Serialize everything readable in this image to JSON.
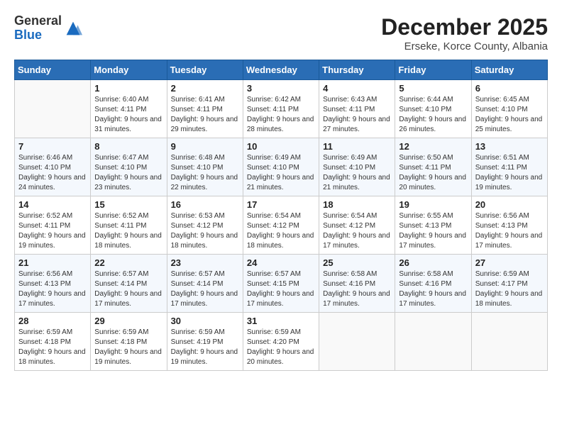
{
  "logo": {
    "general": "General",
    "blue": "Blue"
  },
  "title": "December 2025",
  "subtitle": "Erseke, Korce County, Albania",
  "days_header": [
    "Sunday",
    "Monday",
    "Tuesday",
    "Wednesday",
    "Thursday",
    "Friday",
    "Saturday"
  ],
  "weeks": [
    [
      {
        "day": "",
        "sunrise": "",
        "sunset": "",
        "daylight": ""
      },
      {
        "day": "1",
        "sunrise": "Sunrise: 6:40 AM",
        "sunset": "Sunset: 4:11 PM",
        "daylight": "Daylight: 9 hours and 31 minutes."
      },
      {
        "day": "2",
        "sunrise": "Sunrise: 6:41 AM",
        "sunset": "Sunset: 4:11 PM",
        "daylight": "Daylight: 9 hours and 29 minutes."
      },
      {
        "day": "3",
        "sunrise": "Sunrise: 6:42 AM",
        "sunset": "Sunset: 4:11 PM",
        "daylight": "Daylight: 9 hours and 28 minutes."
      },
      {
        "day": "4",
        "sunrise": "Sunrise: 6:43 AM",
        "sunset": "Sunset: 4:11 PM",
        "daylight": "Daylight: 9 hours and 27 minutes."
      },
      {
        "day": "5",
        "sunrise": "Sunrise: 6:44 AM",
        "sunset": "Sunset: 4:10 PM",
        "daylight": "Daylight: 9 hours and 26 minutes."
      },
      {
        "day": "6",
        "sunrise": "Sunrise: 6:45 AM",
        "sunset": "Sunset: 4:10 PM",
        "daylight": "Daylight: 9 hours and 25 minutes."
      }
    ],
    [
      {
        "day": "7",
        "sunrise": "Sunrise: 6:46 AM",
        "sunset": "Sunset: 4:10 PM",
        "daylight": "Daylight: 9 hours and 24 minutes."
      },
      {
        "day": "8",
        "sunrise": "Sunrise: 6:47 AM",
        "sunset": "Sunset: 4:10 PM",
        "daylight": "Daylight: 9 hours and 23 minutes."
      },
      {
        "day": "9",
        "sunrise": "Sunrise: 6:48 AM",
        "sunset": "Sunset: 4:10 PM",
        "daylight": "Daylight: 9 hours and 22 minutes."
      },
      {
        "day": "10",
        "sunrise": "Sunrise: 6:49 AM",
        "sunset": "Sunset: 4:10 PM",
        "daylight": "Daylight: 9 hours and 21 minutes."
      },
      {
        "day": "11",
        "sunrise": "Sunrise: 6:49 AM",
        "sunset": "Sunset: 4:10 PM",
        "daylight": "Daylight: 9 hours and 21 minutes."
      },
      {
        "day": "12",
        "sunrise": "Sunrise: 6:50 AM",
        "sunset": "Sunset: 4:11 PM",
        "daylight": "Daylight: 9 hours and 20 minutes."
      },
      {
        "day": "13",
        "sunrise": "Sunrise: 6:51 AM",
        "sunset": "Sunset: 4:11 PM",
        "daylight": "Daylight: 9 hours and 19 minutes."
      }
    ],
    [
      {
        "day": "14",
        "sunrise": "Sunrise: 6:52 AM",
        "sunset": "Sunset: 4:11 PM",
        "daylight": "Daylight: 9 hours and 19 minutes."
      },
      {
        "day": "15",
        "sunrise": "Sunrise: 6:52 AM",
        "sunset": "Sunset: 4:11 PM",
        "daylight": "Daylight: 9 hours and 18 minutes."
      },
      {
        "day": "16",
        "sunrise": "Sunrise: 6:53 AM",
        "sunset": "Sunset: 4:12 PM",
        "daylight": "Daylight: 9 hours and 18 minutes."
      },
      {
        "day": "17",
        "sunrise": "Sunrise: 6:54 AM",
        "sunset": "Sunset: 4:12 PM",
        "daylight": "Daylight: 9 hours and 18 minutes."
      },
      {
        "day": "18",
        "sunrise": "Sunrise: 6:54 AM",
        "sunset": "Sunset: 4:12 PM",
        "daylight": "Daylight: 9 hours and 17 minutes."
      },
      {
        "day": "19",
        "sunrise": "Sunrise: 6:55 AM",
        "sunset": "Sunset: 4:13 PM",
        "daylight": "Daylight: 9 hours and 17 minutes."
      },
      {
        "day": "20",
        "sunrise": "Sunrise: 6:56 AM",
        "sunset": "Sunset: 4:13 PM",
        "daylight": "Daylight: 9 hours and 17 minutes."
      }
    ],
    [
      {
        "day": "21",
        "sunrise": "Sunrise: 6:56 AM",
        "sunset": "Sunset: 4:13 PM",
        "daylight": "Daylight: 9 hours and 17 minutes."
      },
      {
        "day": "22",
        "sunrise": "Sunrise: 6:57 AM",
        "sunset": "Sunset: 4:14 PM",
        "daylight": "Daylight: 9 hours and 17 minutes."
      },
      {
        "day": "23",
        "sunrise": "Sunrise: 6:57 AM",
        "sunset": "Sunset: 4:14 PM",
        "daylight": "Daylight: 9 hours and 17 minutes."
      },
      {
        "day": "24",
        "sunrise": "Sunrise: 6:57 AM",
        "sunset": "Sunset: 4:15 PM",
        "daylight": "Daylight: 9 hours and 17 minutes."
      },
      {
        "day": "25",
        "sunrise": "Sunrise: 6:58 AM",
        "sunset": "Sunset: 4:16 PM",
        "daylight": "Daylight: 9 hours and 17 minutes."
      },
      {
        "day": "26",
        "sunrise": "Sunrise: 6:58 AM",
        "sunset": "Sunset: 4:16 PM",
        "daylight": "Daylight: 9 hours and 17 minutes."
      },
      {
        "day": "27",
        "sunrise": "Sunrise: 6:59 AM",
        "sunset": "Sunset: 4:17 PM",
        "daylight": "Daylight: 9 hours and 18 minutes."
      }
    ],
    [
      {
        "day": "28",
        "sunrise": "Sunrise: 6:59 AM",
        "sunset": "Sunset: 4:18 PM",
        "daylight": "Daylight: 9 hours and 18 minutes."
      },
      {
        "day": "29",
        "sunrise": "Sunrise: 6:59 AM",
        "sunset": "Sunset: 4:18 PM",
        "daylight": "Daylight: 9 hours and 19 minutes."
      },
      {
        "day": "30",
        "sunrise": "Sunrise: 6:59 AM",
        "sunset": "Sunset: 4:19 PM",
        "daylight": "Daylight: 9 hours and 19 minutes."
      },
      {
        "day": "31",
        "sunrise": "Sunrise: 6:59 AM",
        "sunset": "Sunset: 4:20 PM",
        "daylight": "Daylight: 9 hours and 20 minutes."
      },
      {
        "day": "",
        "sunrise": "",
        "sunset": "",
        "daylight": ""
      },
      {
        "day": "",
        "sunrise": "",
        "sunset": "",
        "daylight": ""
      },
      {
        "day": "",
        "sunrise": "",
        "sunset": "",
        "daylight": ""
      }
    ]
  ]
}
